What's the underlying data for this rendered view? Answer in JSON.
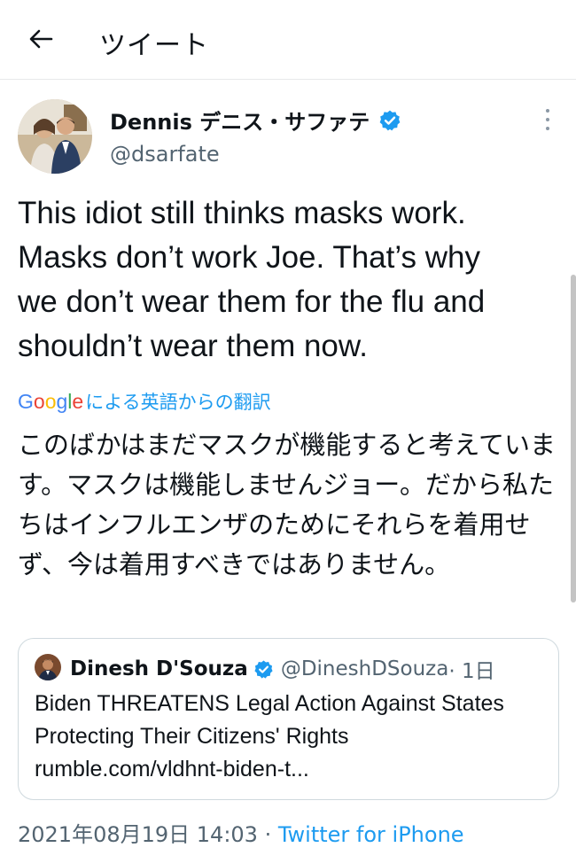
{
  "header": {
    "title": "ツイート",
    "back_icon": "back-arrow-icon"
  },
  "tweet": {
    "display_name": "Dennis デニス・サファテ",
    "handle": "@dsarfate",
    "verified": true,
    "text": "This idiot still thinks masks work.\nMasks don’t work Joe. That’s why\nwe don’t wear them for the flu and\nshouldn’t wear them now.",
    "translation": {
      "google_logo": "Google",
      "label": "による英語からの翻訳",
      "text": "このばかはまだマスクが機能すると考えています。マスクは機能しませんジョー。だから私たちはインフルエンザのためにそれらを着用せず、今は着用すべきではありません。"
    },
    "timestamp": "2021年08月19日 14:03",
    "separator": " · ",
    "source": "Twitter for iPhone"
  },
  "quote": {
    "display_name": "Dinesh D'Souza",
    "handle": "@DineshDSouza",
    "time": "· 1日",
    "text": "Biden THREATENS Legal Action Against States Protecting Their Citizens' Rights rumble.com/vldhnt-biden-t..."
  },
  "colors": {
    "accent": "#1d9bf0",
    "secondary_text": "#536471",
    "border": "#cfd9de"
  }
}
